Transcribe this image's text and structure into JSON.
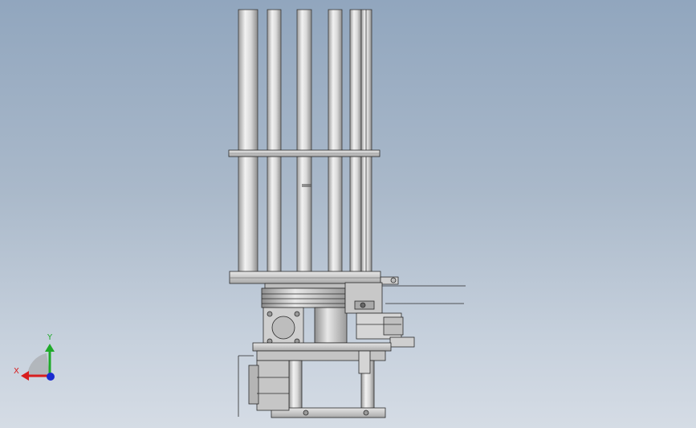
{
  "viewport": {
    "view": "front",
    "background_top": "#91a6be",
    "background_bottom": "#d5dce5"
  },
  "triad": {
    "x_label": "X",
    "y_label": "Y",
    "x_color": "#d81e1e",
    "y_color": "#1faa2a",
    "z_color": "#1a2bd0"
  },
  "model": {
    "part_color": "#c9c9c9",
    "edge_color": "#2a2a2a"
  }
}
